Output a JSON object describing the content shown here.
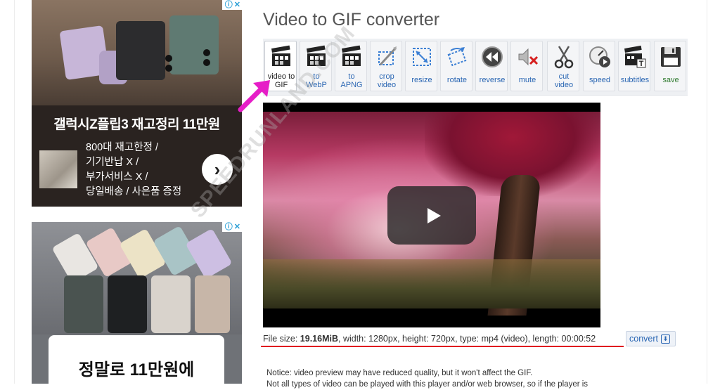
{
  "page": {
    "title": "Video to GIF converter"
  },
  "ads": {
    "ad1": {
      "headline": "갤럭시Z플립3 재고정리 11만원",
      "lines": [
        "800대 재고한정 /",
        "기기반납 X /",
        "부가서비스 X /",
        "당일배송 / 사은품 증정"
      ],
      "next_glyph": "›"
    },
    "ad2": {
      "headline": "정말로 11만원에"
    },
    "badge_info": "ⓘ",
    "badge_close": "✕"
  },
  "toolbar": {
    "items": [
      {
        "id": "video-to-gif",
        "label1": "video to",
        "label2": "GIF",
        "active": true,
        "icon": "clapperboard-icon"
      },
      {
        "id": "to-webp",
        "label1": "to",
        "label2": "WebP",
        "icon": "clapperboard-icon"
      },
      {
        "id": "to-apng",
        "label1": "to",
        "label2": "APNG",
        "icon": "clapperboard-icon"
      },
      {
        "id": "crop-video",
        "label1": "crop",
        "label2": "video",
        "icon": "crop-icon"
      },
      {
        "id": "resize",
        "label1": "resize",
        "icon": "resize-icon"
      },
      {
        "id": "rotate",
        "label1": "rotate",
        "icon": "rotate-icon"
      },
      {
        "id": "reverse",
        "label1": "reverse",
        "icon": "reverse-icon"
      },
      {
        "id": "mute",
        "label1": "mute",
        "icon": "mute-icon"
      },
      {
        "id": "cut-video",
        "label1": "cut",
        "label2": "video",
        "icon": "scissors-icon"
      },
      {
        "id": "speed",
        "label1": "speed",
        "icon": "speed-icon"
      },
      {
        "id": "subtitles",
        "label1": "subtitles",
        "icon": "subtitles-icon"
      },
      {
        "id": "save",
        "label1": "save",
        "icon": "floppy-icon"
      }
    ]
  },
  "video": {
    "watermark": "SPEEDRUNLAND.COM"
  },
  "file_info": {
    "size_label": "File size: ",
    "size_value": "19.16MiB",
    "rest": ", width: 1280px, height: 720px, type: mp4 (video), length: 00:00:52"
  },
  "convert": {
    "label": "convert",
    "icon_glyph": "⬇"
  },
  "notice": {
    "line1": "Notice: video preview may have reduced quality, but it won't affect the GIF.",
    "line2": "Not all types of video can be played with this player and/or web browser, so if the player is"
  },
  "colors": {
    "accent_red": "#e0121f",
    "arrow_pink": "#e61dc7",
    "link_blue": "#2a66b3"
  }
}
